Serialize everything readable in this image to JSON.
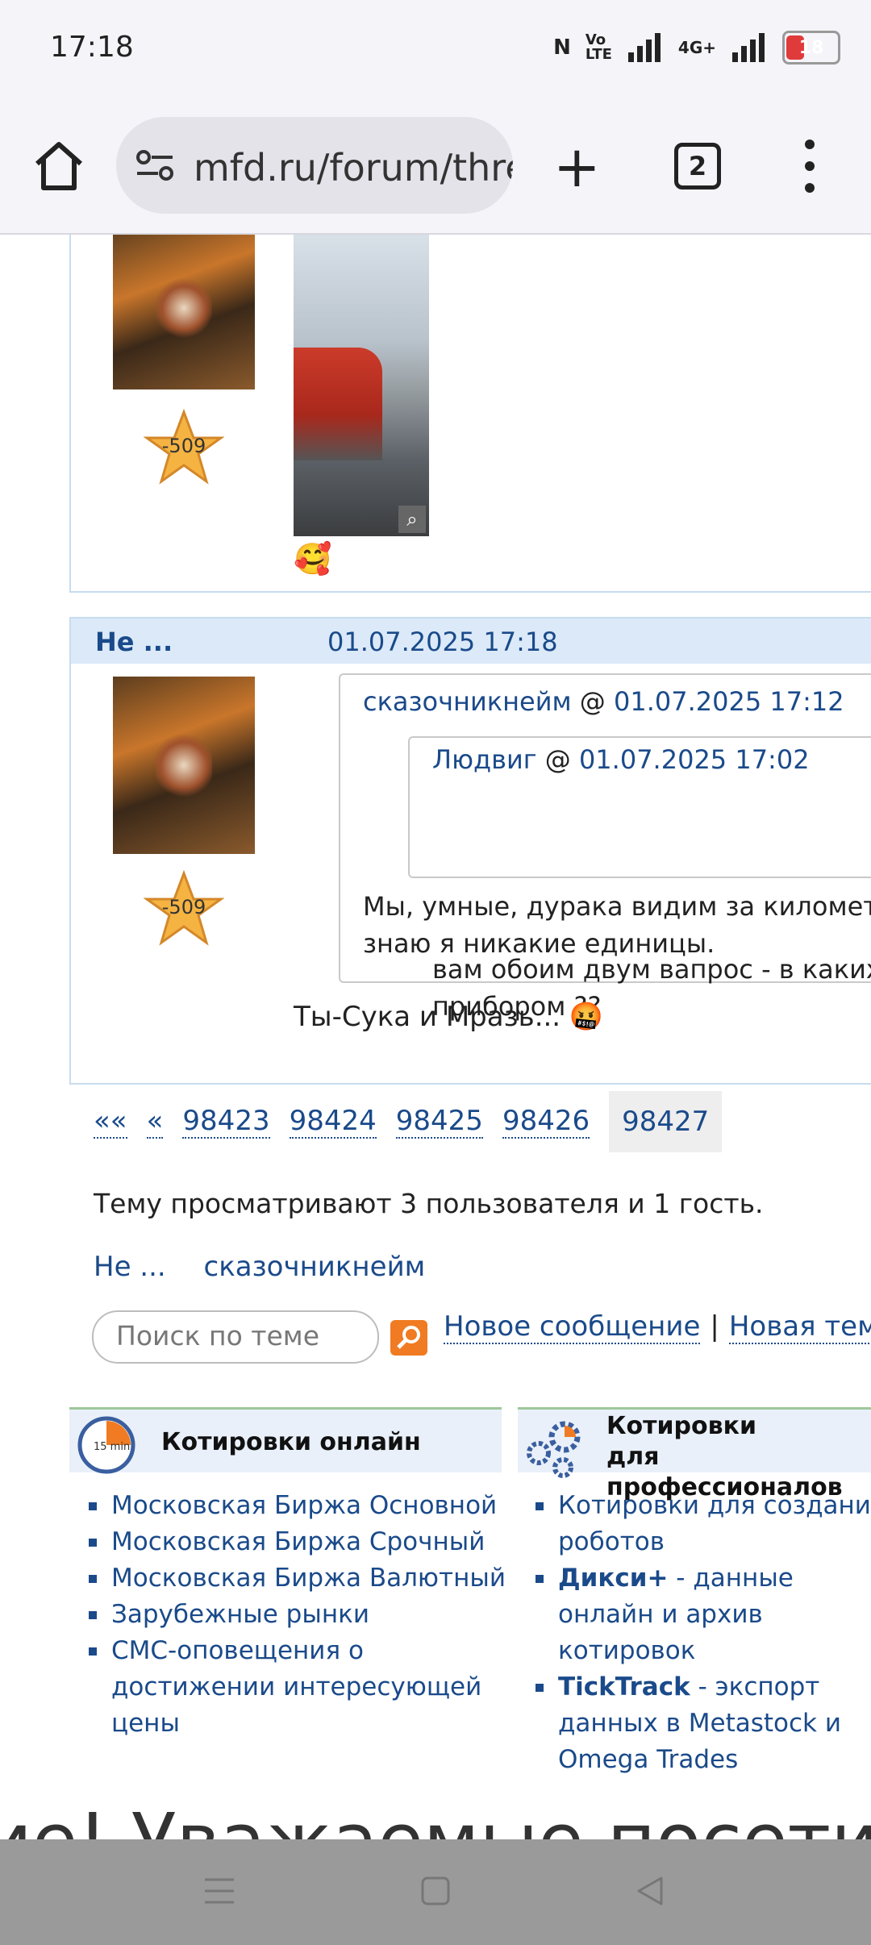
{
  "status": {
    "time": "17:18",
    "network": "4G+",
    "battery": "18"
  },
  "browser": {
    "url": "mfd.ru/forum/thre",
    "tab_count": "2"
  },
  "post1": {
    "rating": "-509",
    "emoji": "🥰"
  },
  "post2": {
    "author": "Не ...",
    "date": "01.07.2025 17:18",
    "rating": "-509",
    "quote_outer": {
      "author": "сказочникнейм",
      "at": "@",
      "date": "01.07.2025 17:12",
      "text": "Мы, умные, дурака видим за километр, а\nзнаю я никакие единицы."
    },
    "quote_inner": {
      "author": "Людвиг",
      "at": "@",
      "date": "01.07.2025 17:02",
      "text": "вам обоим двум вапрос - в каких ед\nприбором ??"
    },
    "message": "Ты-Сука и Мразь... 🤬"
  },
  "pager": {
    "first": "««",
    "prev": "«",
    "pages": [
      "98423",
      "98424",
      "98425",
      "98426"
    ],
    "current": "98427"
  },
  "viewers": {
    "text": "Тему просматривают 3 пользователя и 1 гость.",
    "names": [
      "Не ...",
      "сказочникнейм"
    ]
  },
  "search": {
    "placeholder": "Поиск по теме"
  },
  "actions": {
    "new_message": "Новое сообщение",
    "separator": "|",
    "new_topic": "Новая тема"
  },
  "quotes_online": {
    "title": "Котировки онлайн",
    "clock_label": "15 min",
    "items": [
      "Московская Биржа Основной",
      "Московская Биржа Срочный",
      "Московская Биржа Валютный",
      "Зарубежные рынки",
      "СМС-оповещения о достижении интересующей цены"
    ]
  },
  "quotes_pro": {
    "title_line1": "Котировки",
    "title_line2": "для профессионалов",
    "item1": "Котировки для создания роботов",
    "item2_bold": "Дикси+",
    "item2_rest": " - данные онлайн и архив котировок",
    "item3_bold": "TickTrack",
    "item3_rest": " - экспорт данных в Metastock и Omega Trades"
  },
  "footer_text": "ие! Уважаемые посетител"
}
